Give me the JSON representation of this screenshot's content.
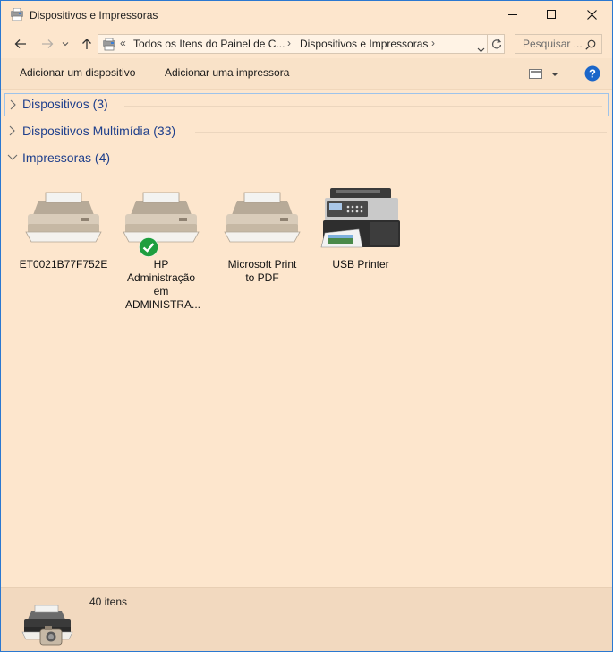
{
  "window": {
    "title": "Dispositivos e Impressoras",
    "accent": "#2b78d0"
  },
  "nav": {
    "back": "back-arrow-icon",
    "forward": "forward-arrow-icon",
    "recent": "chevron-down-icon",
    "up": "up-arrow-icon"
  },
  "address": {
    "overflow": "«",
    "crumbs": [
      "Todos os Itens do Painel de C...",
      "Dispositivos e Impressoras"
    ],
    "separator": "›"
  },
  "search": {
    "placeholder": "Pesquisar ..."
  },
  "toolbar": {
    "add_device": "Adicionar um dispositivo",
    "add_printer": "Adicionar uma impressora"
  },
  "groups": [
    {
      "label": "Dispositivos (3)",
      "expanded": false,
      "selected": true
    },
    {
      "label": "Dispositivos Multimídia (33)",
      "expanded": false,
      "selected": false
    },
    {
      "label": "Impressoras (4)",
      "expanded": true,
      "selected": false
    }
  ],
  "printers": [
    {
      "label": "ET0021B77F752E",
      "icon": "printer-icon",
      "default": false
    },
    {
      "label": "HP Administração em ADMINISTRA...",
      "icon": "printer-icon",
      "default": true
    },
    {
      "label": "Microsoft Print to PDF",
      "icon": "printer-icon",
      "default": false
    },
    {
      "label": "USB Printer",
      "icon": "multifunction-printer-icon",
      "default": false
    }
  ],
  "status": {
    "count": "40 itens"
  },
  "colors": {
    "background": "#fde6cd",
    "group_text": "#1e3f8c",
    "default_check": "#1e9e3e",
    "help": "#1b66c9"
  }
}
